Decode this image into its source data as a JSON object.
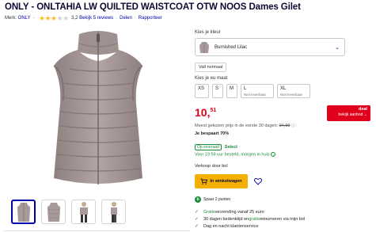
{
  "product": {
    "title": "ONLY - ONLTAHIA LW QUILTED WAISTCOAT OTW NOOS Dames Gilet"
  },
  "meta": {
    "brand_label": "Merk:",
    "brand": "ONLY",
    "rating": 3.2,
    "rating_text": "3,2",
    "reviews_link": "Bekijk 5 reviews",
    "share": "Delen",
    "report": "Rapporteer"
  },
  "color": {
    "label": "Kies je kleur",
    "selected": "Burnished Lilac",
    "swatch_color": "#a89a9a"
  },
  "fit": {
    "tag": "Valt normaal"
  },
  "size": {
    "label": "Kies je eu maat",
    "options": [
      {
        "label": "XS",
        "note": ""
      },
      {
        "label": "S",
        "note": ""
      },
      {
        "label": "M",
        "note": ""
      },
      {
        "label": "L",
        "note": "Niet leverbaar"
      },
      {
        "label": "XL",
        "note": "Niet leverbaar"
      }
    ]
  },
  "price": {
    "whole": "10,",
    "cents": "51",
    "deal_title": "deal",
    "deal_sub": "bekijk aanbod",
    "lowest_text": "Meest gekozen prijs in de eerste 30 dagen:",
    "lowest_value": "34,99",
    "saving": "Je bespaart 70%"
  },
  "availability": {
    "stock": "Op voorraad",
    "select": "Select",
    "delivery": "Voor 23:59 uur besteld, morgen in huis",
    "seller": "Verkoop door bol"
  },
  "actions": {
    "cart": "In winkelwagen"
  },
  "points": {
    "text": "Spaar 2 punten",
    "coin": "b"
  },
  "usps": [
    {
      "prefix": "Gratis",
      "text": " verzending vanaf 25 euro",
      "mid": "",
      "rest": ""
    },
    {
      "prefix": "",
      "text": "30 dagen bedenktijd en ",
      "mid": "gratis",
      "rest": " retourneren via mijn bol"
    },
    {
      "prefix": "",
      "text": "Dag en nacht klantenservice",
      "mid": "",
      "rest": ""
    }
  ],
  "colors": {
    "accent": "#0000a4",
    "price": "#e0001b",
    "cta": "#f4b000",
    "success": "#1a8b3b",
    "vest": "#a89a9a"
  }
}
